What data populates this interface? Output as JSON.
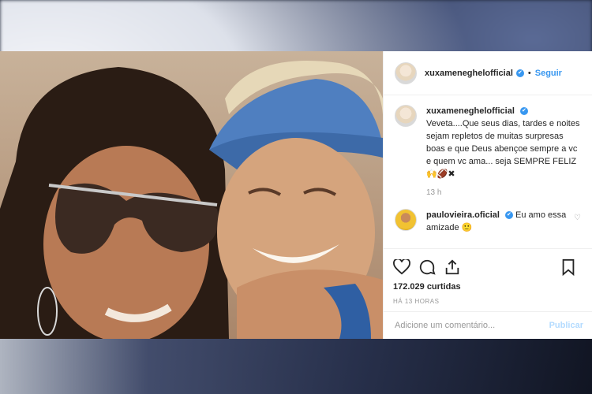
{
  "post": {
    "username": "xuxameneghelofficial",
    "verified_badge": "✔",
    "follow_label": "Seguir",
    "separator": "•"
  },
  "caption": {
    "username": "xuxameneghelofficial",
    "text": "Veveta....Que seus dias, tardes e noites sejam repletos de muitas surpresas boas e que Deus abençoe sempre a vc e quem vc ama... seja SEMPRE FELIZ",
    "emojis": "🙌🏈✖",
    "time": "13 h"
  },
  "comment": {
    "username": "paulovieira.oficial",
    "text": "Eu amo essa amizade",
    "emoji": "🙂"
  },
  "likes": "172.029 curtidas",
  "posted_ago": "HÁ 13 HORAS",
  "add_comment": {
    "placeholder": "Adicione um comentário...",
    "publish_label": "Publicar"
  },
  "colors": {
    "link_blue": "#3897f0",
    "publish_disabled": "#b3dbff",
    "muted": "#999999",
    "text": "#262626"
  },
  "icons": [
    "heart-icon",
    "comment-icon",
    "share-icon",
    "bookmark-icon",
    "verified-icon",
    "small-heart-icon"
  ]
}
